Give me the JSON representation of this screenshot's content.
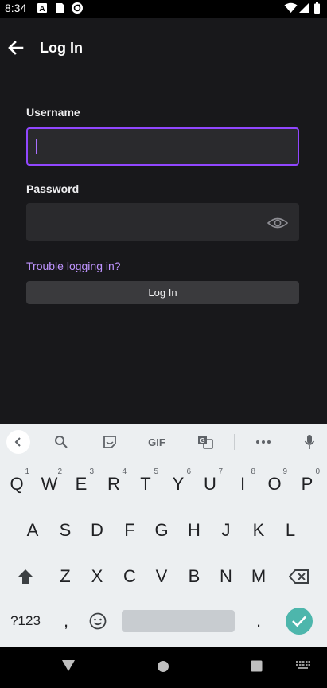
{
  "status_bar": {
    "time": "8:34",
    "left_icons": [
      "font-a-icon",
      "sd-card-icon",
      "sync-icon"
    ],
    "right_icons": [
      "wifi-icon",
      "cell-signal-icon",
      "battery-icon"
    ]
  },
  "header": {
    "title": "Log In",
    "back_icon": "arrow-left-icon"
  },
  "form": {
    "username_label": "Username",
    "username_value": "",
    "password_label": "Password",
    "password_value": "",
    "trouble_link": "Trouble logging in?",
    "login_button": "Log In"
  },
  "colors": {
    "accent": "#9147ff",
    "link": "#bf94ff",
    "background": "#18181b",
    "field": "#2a2a2d",
    "button": "#3a3a3d",
    "keyboard": "#eceff1",
    "enter": "#4db6ac"
  },
  "keyboard": {
    "toolbar": [
      "chevron-left-icon",
      "search-icon",
      "sticker-icon",
      "GIF",
      "translate-icon",
      "more-icon",
      "mic-icon"
    ],
    "gif_label": "GIF",
    "row1": [
      {
        "key": "Q",
        "hint": "1"
      },
      {
        "key": "W",
        "hint": "2"
      },
      {
        "key": "E",
        "hint": "3"
      },
      {
        "key": "R",
        "hint": "4"
      },
      {
        "key": "T",
        "hint": "5"
      },
      {
        "key": "Y",
        "hint": "6"
      },
      {
        "key": "U",
        "hint": "7"
      },
      {
        "key": "I",
        "hint": "8"
      },
      {
        "key": "O",
        "hint": "9"
      },
      {
        "key": "P",
        "hint": "0"
      }
    ],
    "row2": [
      "A",
      "S",
      "D",
      "F",
      "G",
      "H",
      "J",
      "K",
      "L"
    ],
    "row3": [
      "Z",
      "X",
      "C",
      "V",
      "B",
      "N",
      "M"
    ],
    "symbols_key": "?123",
    "comma_key": ",",
    "period_key": ".",
    "shift_icon": "shift-icon",
    "backspace_icon": "backspace-icon",
    "emoji_icon": "emoji-icon",
    "enter_icon": "checkmark-icon"
  },
  "nav_bar": {
    "icons": [
      "back-triangle-icon",
      "home-circle-icon",
      "recents-square-icon",
      "keyboard-switch-icon"
    ]
  }
}
